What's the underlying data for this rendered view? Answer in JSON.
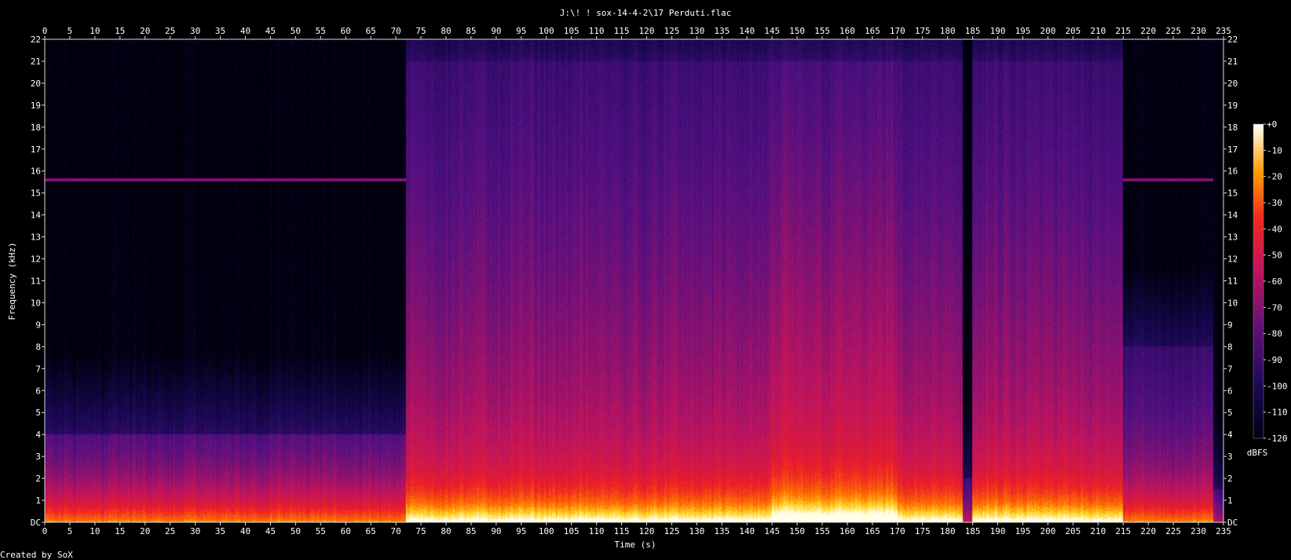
{
  "chart_data": {
    "type": "heatmap",
    "kind": "spectrogram",
    "title": "J:\\! ! sox-14-4-2\\17 Perduti.flac",
    "xlabel": "Time (s)",
    "ylabel": "Frequency (kHz)",
    "xlim": [
      0,
      235
    ],
    "ylim": [
      0,
      22
    ],
    "x_ticks": [
      "0",
      "5",
      "10",
      "15",
      "20",
      "25",
      "30",
      "35",
      "40",
      "45",
      "50",
      "55",
      "60",
      "65",
      "70",
      "75",
      "80",
      "85",
      "90",
      "95",
      "100",
      "105",
      "110",
      "115",
      "120",
      "125",
      "130",
      "135",
      "140",
      "145",
      "150",
      "155",
      "160",
      "165",
      "170",
      "175",
      "180",
      "185",
      "190",
      "195",
      "200",
      "205",
      "210",
      "215",
      "220",
      "225",
      "230",
      "235"
    ],
    "y_ticks": [
      "DC",
      "1",
      "2",
      "3",
      "4",
      "5",
      "6",
      "7",
      "8",
      "9",
      "10",
      "11",
      "12",
      "13",
      "14",
      "15",
      "16",
      "17",
      "18",
      "19",
      "20",
      "21",
      "22"
    ],
    "colorbar": {
      "label": "dBFS",
      "range": [
        -120,
        0
      ],
      "ticks": [
        "+0",
        "-10",
        "-20",
        "-30",
        "-40",
        "-50",
        "-60",
        "-70",
        "-80",
        "-90",
        "-100",
        "-110",
        "-120"
      ]
    },
    "energy_profile": {
      "note": "approx. upper frequency (kHz) reached by strong energy, and overall level, per time segment",
      "segments": [
        {
          "t": [
            0,
            72
          ],
          "high_energy_kHz": 4,
          "level": "medium",
          "tone_line_kHz": 15.6
        },
        {
          "t": [
            72,
            98
          ],
          "high_energy_kHz": 21,
          "level": "high"
        },
        {
          "t": [
            98,
            145
          ],
          "high_energy_kHz": 21,
          "level": "high"
        },
        {
          "t": [
            145,
            170
          ],
          "high_energy_kHz": 21,
          "level": "very-high"
        },
        {
          "t": [
            170,
            183
          ],
          "high_energy_kHz": 21,
          "level": "high"
        },
        {
          "t": [
            183,
            185
          ],
          "high_energy_kHz": 2,
          "level": "low"
        },
        {
          "t": [
            185,
            215
          ],
          "high_energy_kHz": 21,
          "level": "high"
        },
        {
          "t": [
            215,
            233
          ],
          "high_energy_kHz": 8,
          "level": "medium",
          "tone_line_kHz": 15.6
        }
      ]
    }
  },
  "footer": {
    "credit": "Created by SoX"
  },
  "colors": {
    "background": "#000000",
    "axis": "#ffffff",
    "low": "#10062e",
    "mid": "#c8145a",
    "high": "#ffd21e",
    "peak": "#ffffe6"
  }
}
